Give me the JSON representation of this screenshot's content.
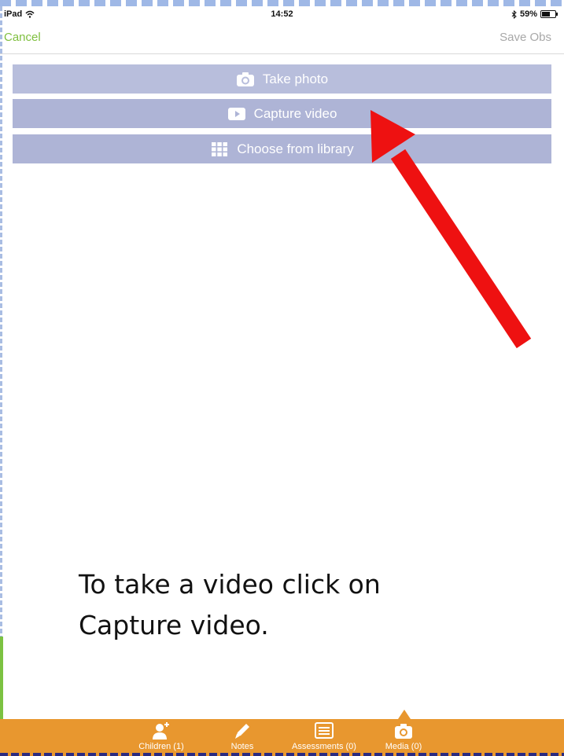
{
  "status_bar": {
    "device": "iPad",
    "time": "14:52",
    "battery": "59%"
  },
  "nav": {
    "cancel_label": "Cancel",
    "save_label": "Save Obs"
  },
  "actions": [
    {
      "label": "Take photo",
      "icon": "camera-icon"
    },
    {
      "label": "Capture video",
      "icon": "play-icon"
    },
    {
      "label": "Choose from library",
      "icon": "grid-icon"
    }
  ],
  "caption": {
    "line1": "To take a video click on",
    "line2": "Capture video."
  },
  "tabs": [
    {
      "label": "Children (1)",
      "icon": "add-child-icon"
    },
    {
      "label": "Notes",
      "icon": "pencil-icon"
    },
    {
      "label": "Assessments (0)",
      "icon": "list-icon"
    },
    {
      "label": "Media (0)",
      "icon": "camera-icon"
    }
  ],
  "colors": {
    "accent_green": "#7fbf3f",
    "button_lavender": "#b8bedc",
    "tab_bar_orange": "#e8972f",
    "arrow_red": "#ee1111"
  }
}
